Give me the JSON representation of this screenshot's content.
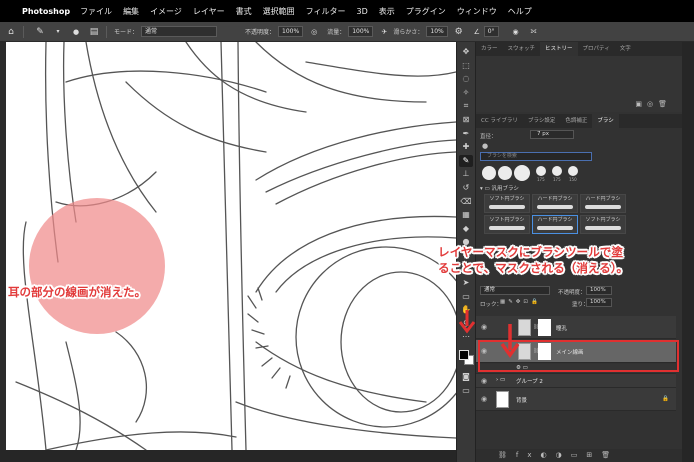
{
  "menubar": {
    "apple_glyph": "",
    "app_name": "Photoshop",
    "items": [
      "ファイル",
      "編集",
      "イメージ",
      "レイヤー",
      "書式",
      "選択範囲",
      "フィルター",
      "3D",
      "表示",
      "プラグイン",
      "ウィンドウ",
      "ヘルプ"
    ]
  },
  "options_bar": {
    "mode_label": "モード：",
    "mode_value": "通常",
    "opacity_label": "不透明度：",
    "opacity_value": "100%",
    "flow_label": "流量：",
    "flow_value": "100%",
    "smoothing_label": "滑らかさ：",
    "smoothing_value": "10%",
    "angle_value": "0°"
  },
  "history_panel": {
    "tabs": [
      "カラー",
      "スウォッチ",
      "ヒストリー",
      "プロパティ",
      "文字"
    ],
    "active_tab": "ヒストリー"
  },
  "brush_panel": {
    "tabs": [
      "CC ライブラリ",
      "ブラシ設定",
      "色調補正",
      "ブラシ"
    ],
    "active_tab": "ブラシ",
    "size_label": "直径：",
    "size_value": "7 px",
    "search_placeholder": "ブラシを検索",
    "tip_sizes": [
      "175",
      "175",
      "150"
    ],
    "folder_label": "汎用ブラシ",
    "presets": [
      "ソフト円ブラシ",
      "ハード円ブラシ",
      "ハード円ブラシ",
      "ソフト円ブラシ",
      "ハード円ブラシ",
      "ソフト円ブラシ"
    ],
    "selected_preset_index": 4
  },
  "layers_panel": {
    "blend_mode": "通常",
    "opacity_label": "不透明度：",
    "opacity_value": "100%",
    "lock_label": "ロック：",
    "fill_label": "塗り：",
    "fill_value": "100%",
    "layers": [
      {
        "name": "瞳孔",
        "visible": true,
        "has_mask": true,
        "selected": false
      },
      {
        "name": "メイン線画",
        "visible": true,
        "has_mask": true,
        "selected": true
      },
      {
        "name": "グループ 2",
        "visible": true,
        "is_group": true,
        "selected": false
      },
      {
        "name": "背景",
        "visible": true,
        "selected": false
      }
    ]
  },
  "annotations": {
    "left_note": "耳の部分の線画が消えた。",
    "right_note_line1": "レイヤーマスクにブラシツールで塗",
    "right_note_line2": "ることで、マスクされる（消える）。",
    "accent_color": "#e03030",
    "erased_area_color": "#f08a8a"
  },
  "colors": {
    "foreground": "#000000",
    "background": "#ffffff"
  }
}
